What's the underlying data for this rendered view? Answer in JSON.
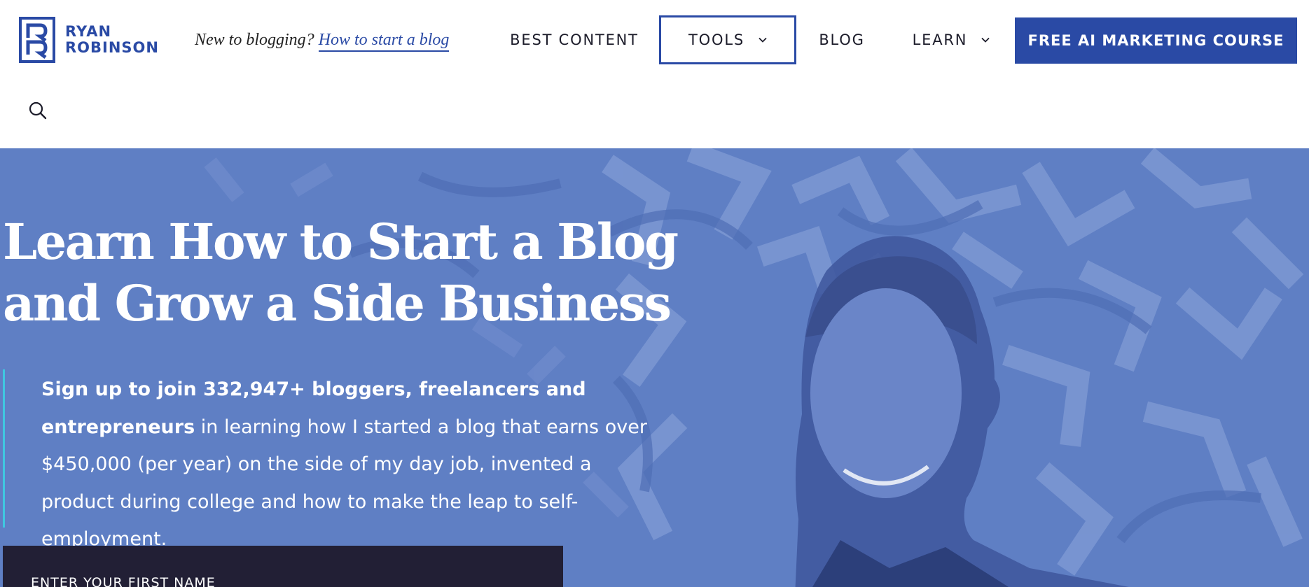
{
  "brand": {
    "name_line1": "RYAN",
    "name_line2": "ROBINSON",
    "color": "#2a4aa5"
  },
  "tagline": {
    "prefix": "New to blogging?",
    "link": "How to start a blog"
  },
  "nav": {
    "best_content": "BEST CONTENT",
    "tools": "TOOLS",
    "blog": "BLOG",
    "learn": "LEARN",
    "cta": "FREE AI MARKETING COURSE"
  },
  "icons": {
    "search": "search-icon",
    "caret": "chevron-down-icon"
  },
  "hero": {
    "title_line1": "Learn How to Start a Blog",
    "title_line2": "and Grow a Side Business",
    "intro_bold": "Sign up to join 332,947+ bloggers, freelancers and entrepreneurs",
    "intro_rest": " in learning how I started a blog that earns over $450,000 (per year) on the side of my day job, invented a product during college and how to make the leap to self-employment.",
    "first_name_placeholder": "ENTER YOUR FIRST NAME",
    "accent_color": "#3fc7e0",
    "overlay_color": "#5f7fc4"
  }
}
